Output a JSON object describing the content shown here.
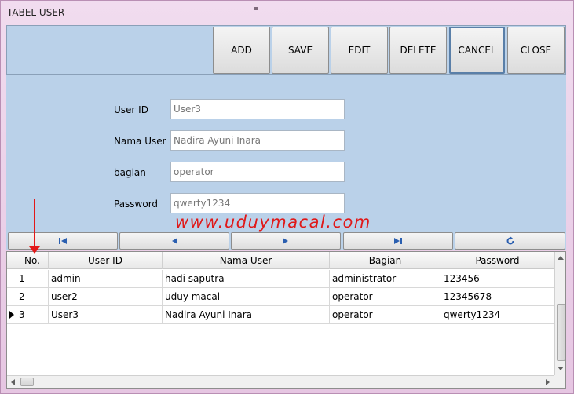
{
  "window": {
    "title": "TABEL USER"
  },
  "toolbar": {
    "buttons": [
      {
        "label": "ADD"
      },
      {
        "label": "SAVE"
      },
      {
        "label": "EDIT"
      },
      {
        "label": "DELETE"
      },
      {
        "label": "CANCEL",
        "focused": true
      },
      {
        "label": "CLOSE"
      }
    ]
  },
  "form": {
    "user_id": {
      "label": "User ID",
      "value": "User3"
    },
    "nama_user": {
      "label": "Nama User",
      "value": "Nadira Ayuni Inara"
    },
    "bagian": {
      "label": "bagian",
      "value": "operator"
    },
    "password": {
      "label": "Password",
      "value": "qwerty1234"
    }
  },
  "watermark": "www.uduymacal.com",
  "navigator": {
    "icons": [
      "first-record-icon",
      "previous-record-icon",
      "next-record-icon",
      "last-record-icon",
      "refresh-icon"
    ]
  },
  "grid": {
    "columns": [
      "No.",
      "User ID",
      "Nama User",
      "Bagian",
      "Password"
    ],
    "rows": [
      {
        "no": "1",
        "user_id": "admin",
        "nama_user": "hadi saputra",
        "bagian": "administrator",
        "password": "123456"
      },
      {
        "no": "2",
        "user_id": "user2",
        "nama_user": "uduy macal",
        "bagian": "operator",
        "password": "12345678"
      },
      {
        "no": "3",
        "user_id": "User3",
        "nama_user": "Nadira Ayuni Inara",
        "bagian": "operator",
        "password": "qwerty1234",
        "current": true
      }
    ]
  },
  "colors": {
    "panel": "#bad1e9",
    "window": "#e9cde6",
    "annotation": "#e01818"
  }
}
